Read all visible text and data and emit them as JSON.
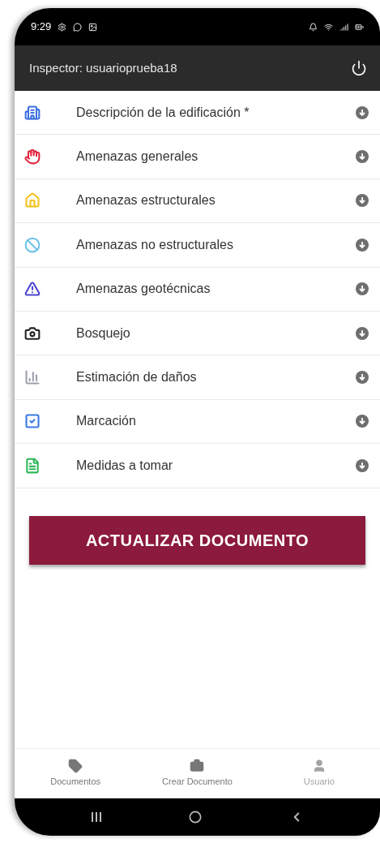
{
  "status_bar": {
    "time": "9:29"
  },
  "header": {
    "title": "Inspector: usuarioprueba18"
  },
  "sections": [
    {
      "kind": "building",
      "label": "Descripción de la edificación *"
    },
    {
      "kind": "hand",
      "label": "Amenazas generales"
    },
    {
      "kind": "house",
      "label": "Amenazas estructurales"
    },
    {
      "kind": "ban",
      "label": "Amenazas no estructurales"
    },
    {
      "kind": "warning",
      "label": "Amenazas geotécnicas"
    },
    {
      "kind": "camera",
      "label": "Bosquejo"
    },
    {
      "kind": "chart",
      "label": "Estimación de daños"
    },
    {
      "kind": "checkbox",
      "label": "Marcación"
    },
    {
      "kind": "file",
      "label": "Medidas a tomar"
    }
  ],
  "action_button": {
    "label": "ACTUALIZAR DOCUMENTO"
  },
  "tab_bar": [
    {
      "kind": "tag",
      "label": "Documentos",
      "disabled": false
    },
    {
      "kind": "briefcase",
      "label": "Crear Documento",
      "disabled": false
    },
    {
      "kind": "user",
      "label": "Usuario",
      "disabled": true
    }
  ]
}
